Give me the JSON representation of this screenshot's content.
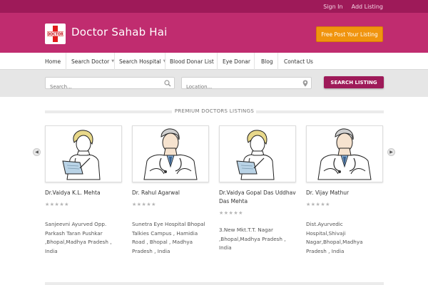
{
  "topbar": {
    "sign_in": "Sign In",
    "add_listing": "Add Listing"
  },
  "header": {
    "logo_text": "DOCTOR",
    "site_name": "Doctor Sahab Hai",
    "cta_label": "Free Post Your Listing"
  },
  "nav": {
    "items": [
      {
        "label": "Home"
      },
      {
        "label": "Search Doctor"
      },
      {
        "label": "Search Hospital"
      },
      {
        "label": "Blood Donar List"
      },
      {
        "label": "Eye Donar"
      },
      {
        "label": "Blog"
      },
      {
        "label": "Contact Us"
      }
    ]
  },
  "search": {
    "keyword_placeholder": "Search...",
    "location_placeholder": "Location...",
    "button_label": "SEARCH LISTING"
  },
  "section": {
    "title": "PREMIUM DOCTORS LISTINGS"
  },
  "listings": [
    {
      "name": "Dr.Vaidya K.L. Mehta",
      "rating": "★★★★★",
      "address": "Sanjeevni Ayurved Opp. Parkash Taran Pushkar ,Bhopal,Madhya Pradesh , India",
      "image": "female-doctor-illustration"
    },
    {
      "name": "Dr. Rahul Agarwal",
      "rating": "★★★★★",
      "address": "Sunetra Eye Hospital Bhopal Talkies Campus , Hamidia Road , Bhopal , Madhya Pradesh , India",
      "image": "male-doctor-illustration"
    },
    {
      "name": "Dr.Vaidya Gopal Das Uddhav Das Mehta",
      "rating": "★★★★★",
      "address": "3.New Mkt.T.T. Nagar ,Bhopal,Madhya Pradesh , India",
      "image": "female-doctor-illustration"
    },
    {
      "name": "Dr. Vijay Mathur",
      "rating": "★★★★★",
      "address": "Dist.Ayurvedic Hospital,Shivaji Nagar,Bhopal,Madhya Pradesh , India",
      "image": "male-doctor-illustration"
    }
  ],
  "colors": {
    "topbar": "#9e1a59",
    "header": "#c02c6f",
    "cta": "#f0940e",
    "search_button": "#9e1a59"
  }
}
